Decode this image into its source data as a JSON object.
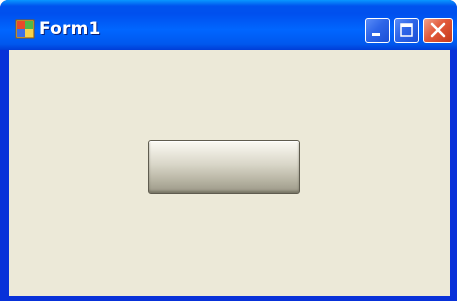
{
  "window": {
    "title": "Form1",
    "app_icon": "windows-form-icon",
    "controls": {
      "minimize_icon": "minimize-icon",
      "maximize_icon": "maximize-icon",
      "close_icon": "close-icon"
    }
  },
  "form": {
    "button1": {
      "label": ""
    }
  },
  "colors": {
    "titlebar": "#0055e5",
    "client_background": "#ece9d8",
    "close_button": "#e2593a"
  }
}
